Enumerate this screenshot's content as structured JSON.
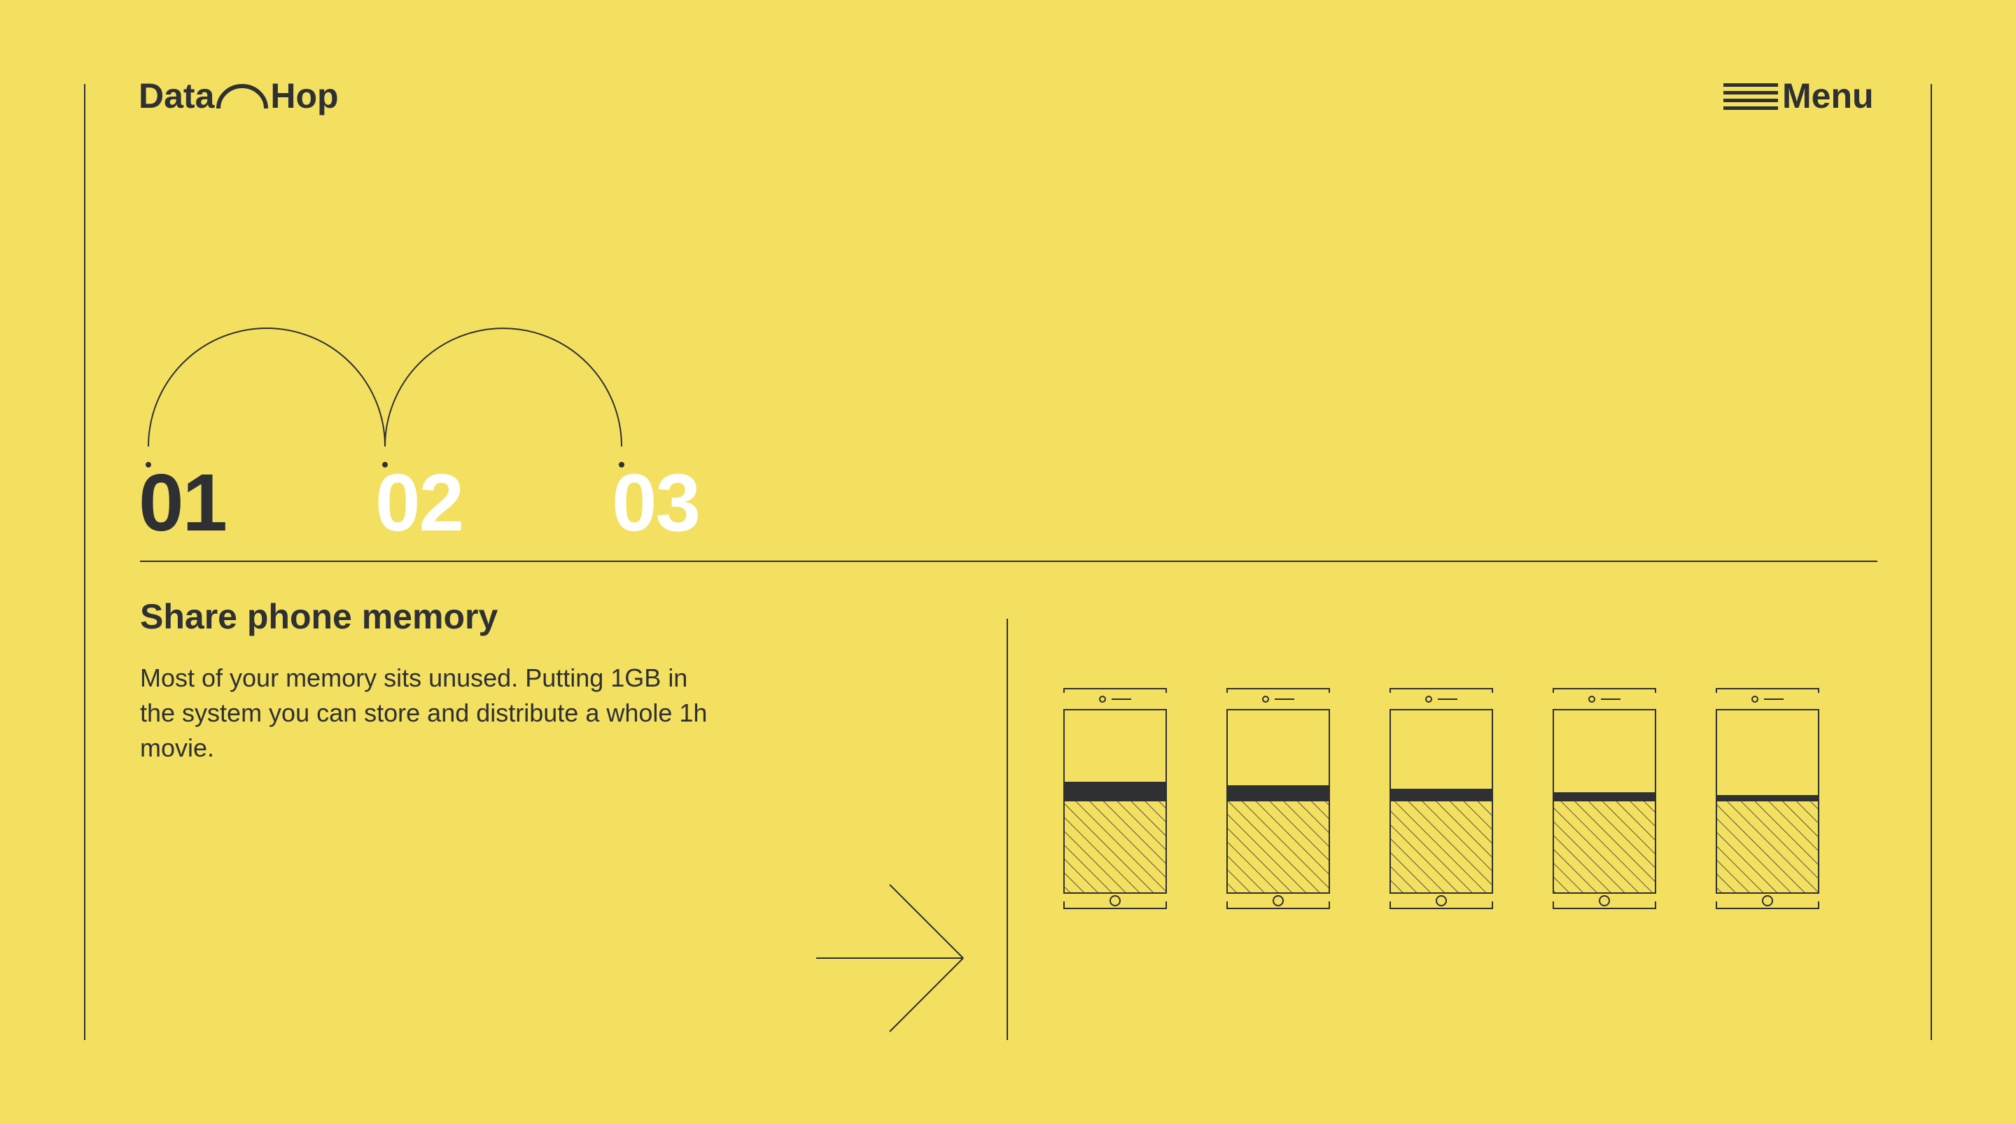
{
  "brand": {
    "name_left": "Data",
    "name_right": "Hop",
    "logo_icon": "arch-icon"
  },
  "nav": {
    "menu_label": "Menu",
    "menu_icon": "hamburger-icon"
  },
  "steps": [
    {
      "number": "01",
      "active": true
    },
    {
      "number": "02",
      "active": false
    },
    {
      "number": "03",
      "active": false
    }
  ],
  "content": {
    "title": "Share phone memory",
    "description": "Most of your memory sits unused. Putting 1GB in the system you can store and distribute a whole 1h movie."
  },
  "illustration": {
    "phones": [
      {
        "memory_used_fraction": 0.205
      },
      {
        "memory_used_fraction": 0.17
      },
      {
        "memory_used_fraction": 0.13
      },
      {
        "memory_used_fraction": 0.095
      },
      {
        "memory_used_fraction": 0.06
      }
    ]
  },
  "colors": {
    "background": "#f3e060",
    "ink": "#2e3033",
    "inactive_step": "#ffffff"
  }
}
